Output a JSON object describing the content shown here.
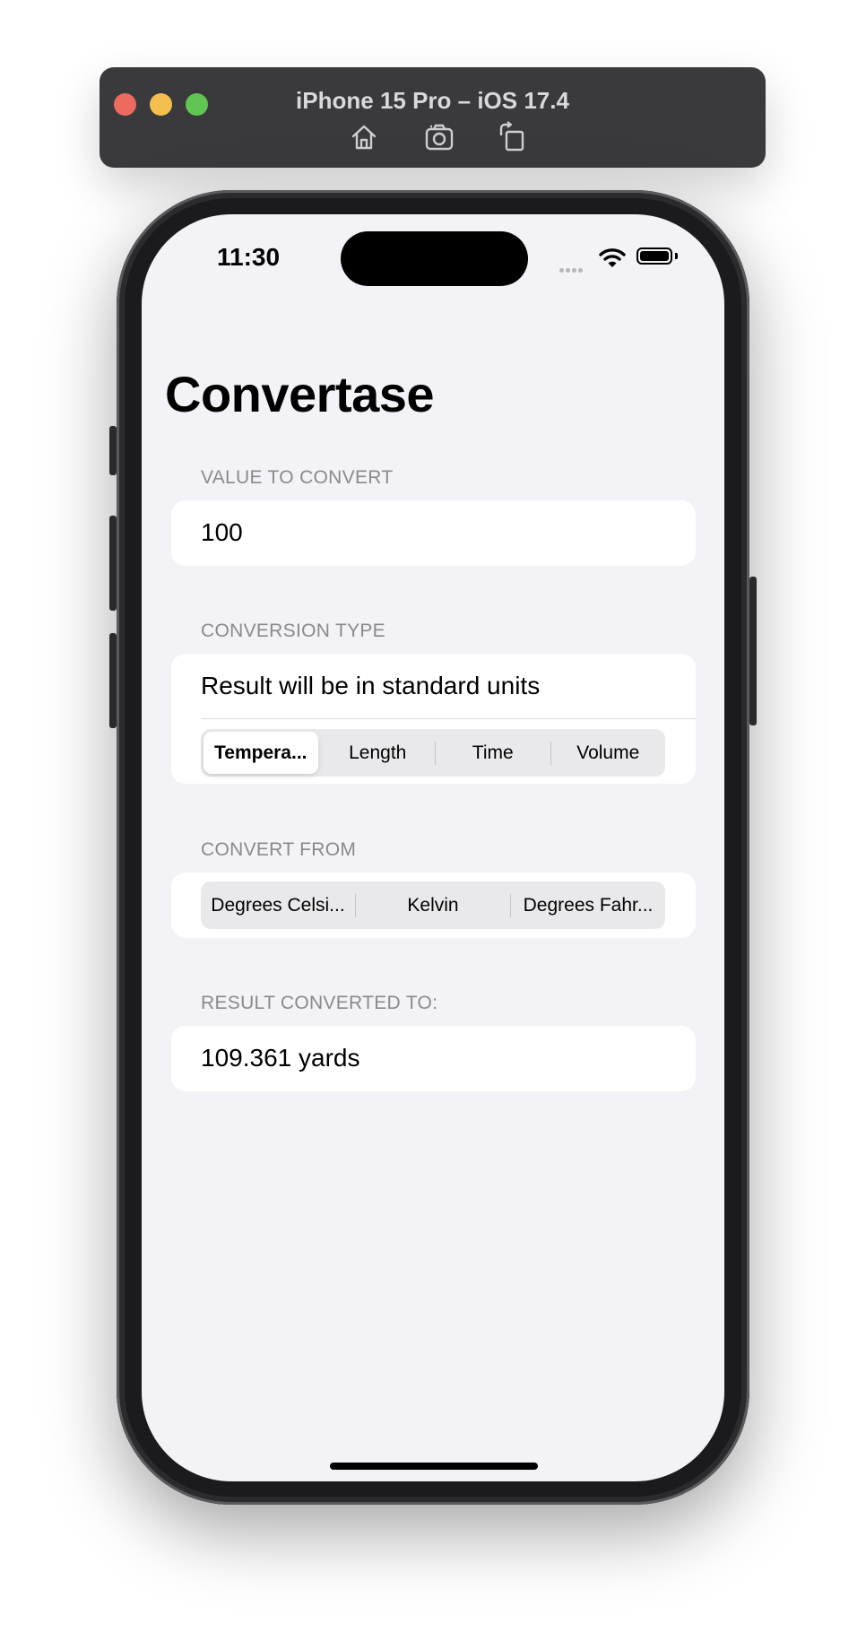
{
  "simulator": {
    "title": "iPhone 15 Pro – iOS 17.4",
    "toolbar_icons": [
      "home-icon",
      "screenshot-icon",
      "rotate-icon"
    ]
  },
  "status_bar": {
    "time": "11:30"
  },
  "app": {
    "title": "Convertase",
    "value_section": {
      "header": "VALUE TO CONVERT",
      "value": "100"
    },
    "conversion_type_section": {
      "header": "CONVERSION TYPE",
      "note": "Result will be in standard units",
      "options": [
        "Tempera...",
        "Length",
        "Time",
        "Volume"
      ],
      "selected": "Tempera..."
    },
    "convert_from_section": {
      "header": "CONVERT FROM",
      "options": [
        "Degrees Celsi...",
        "Kelvin",
        "Degrees Fahr..."
      ]
    },
    "result_section": {
      "header": "RESULT CONVERTED TO:",
      "value": "109.361 yards"
    }
  }
}
